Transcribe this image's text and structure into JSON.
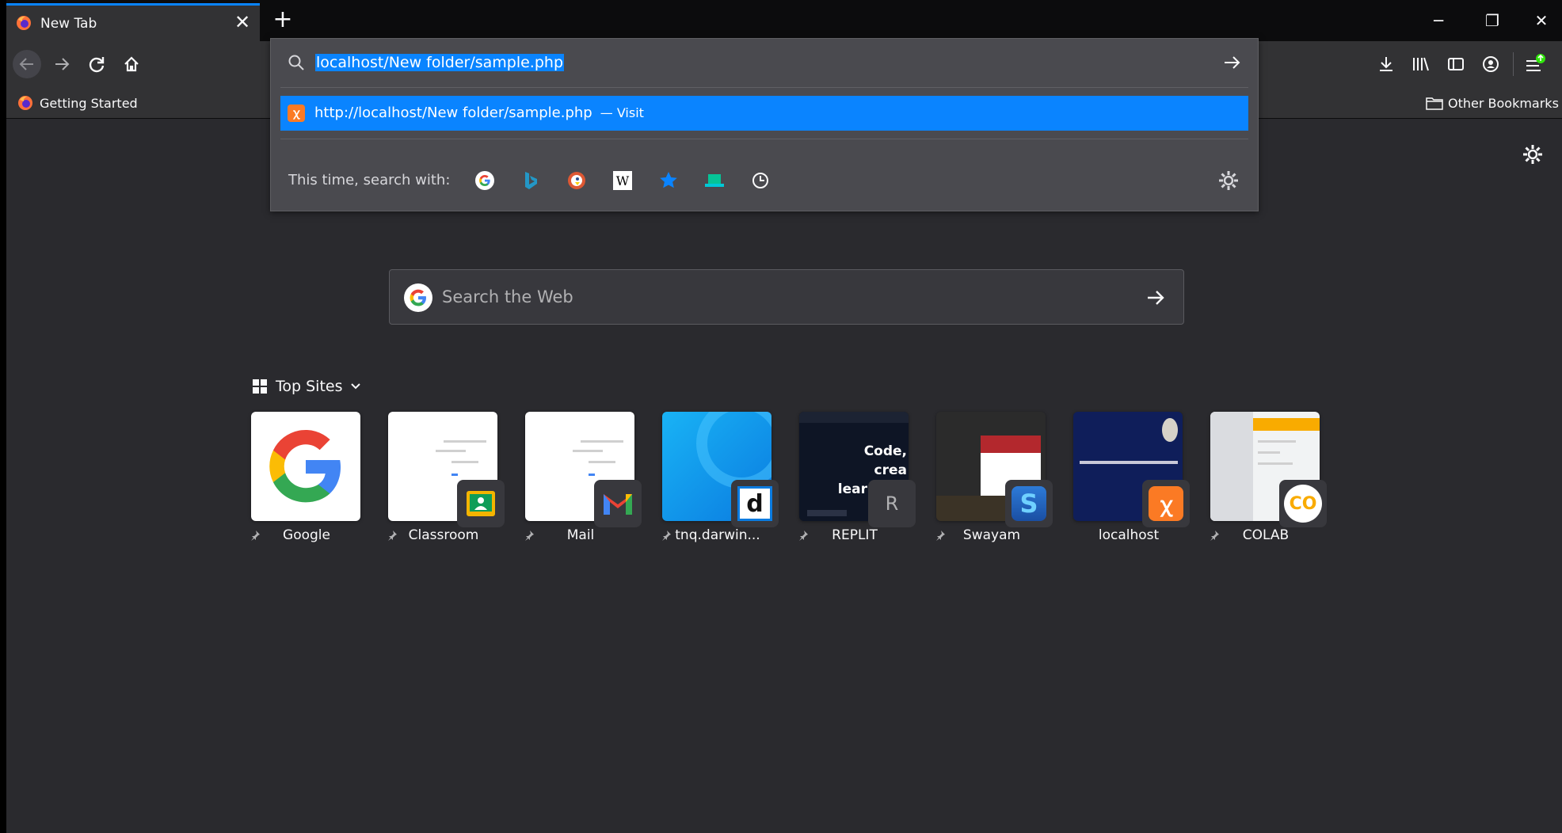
{
  "tab": {
    "title": "New Tab",
    "close": "✕"
  },
  "new_tab_symbol": "+",
  "window_controls": [
    "─",
    "❐",
    "✕"
  ],
  "bookmarks_bar": {
    "getting_started": "Getting Started",
    "other": "Other Bookmarks"
  },
  "urlbar": {
    "value": "localhost/New folder/sample.php",
    "result_url": "http://localhost/New folder/sample.php",
    "result_action": "— Visit",
    "search_with_label": "This time, search with:",
    "engines": [
      "google-icon",
      "bing-icon",
      "duckduckgo-icon",
      "wikipedia-icon",
      "bookmarks-star-icon",
      "tabs-icon",
      "history-clock-icon"
    ]
  },
  "websearch": {
    "placeholder": "Search the Web"
  },
  "top_sites": {
    "header": "Top Sites",
    "sites": [
      {
        "label": "Google"
      },
      {
        "label": "Classroom"
      },
      {
        "label": "Mail"
      },
      {
        "label": "tnq.darwin..."
      },
      {
        "label": "REPLIT",
        "badge_letter": "R",
        "thumb_text": "Code, crea learn tog"
      },
      {
        "label": "Swayam"
      },
      {
        "label": "localhost"
      },
      {
        "label": "COLAB",
        "badge_text": "CO"
      }
    ]
  },
  "colors": {
    "accent": "#0a84ff",
    "background": "#2a2a2e",
    "toolbar": "#323234",
    "panel": "#4a4a4f"
  }
}
